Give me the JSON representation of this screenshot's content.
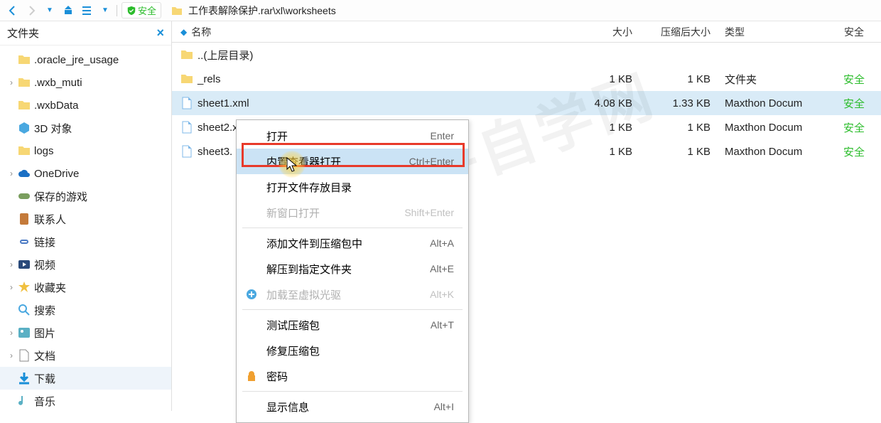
{
  "toolbar": {
    "safe_label": "安全",
    "path": "工作表解除保护.rar\\xl\\worksheets"
  },
  "sidebar": {
    "header": "文件夹",
    "items": [
      {
        "label": ".oracle_jre_usage",
        "expander": "",
        "icon": "folder"
      },
      {
        "label": ".wxb_muti",
        "expander": "›",
        "icon": "folder"
      },
      {
        "label": ".wxbData",
        "expander": "",
        "icon": "folder"
      },
      {
        "label": "3D 对象",
        "expander": "",
        "icon": "3d"
      },
      {
        "label": "logs",
        "expander": "",
        "icon": "folder"
      },
      {
        "label": "OneDrive",
        "expander": "›",
        "icon": "cloud"
      },
      {
        "label": "保存的游戏",
        "expander": "",
        "icon": "game"
      },
      {
        "label": "联系人",
        "expander": "",
        "icon": "contacts"
      },
      {
        "label": "链接",
        "expander": "",
        "icon": "link"
      },
      {
        "label": "视频",
        "expander": "›",
        "icon": "video"
      },
      {
        "label": "收藏夹",
        "expander": "›",
        "icon": "star"
      },
      {
        "label": "搜索",
        "expander": "",
        "icon": "search"
      },
      {
        "label": "图片",
        "expander": "›",
        "icon": "picture"
      },
      {
        "label": "文档",
        "expander": "›",
        "icon": "doc"
      },
      {
        "label": "下载",
        "expander": "",
        "icon": "download",
        "selected": true
      },
      {
        "label": "音乐",
        "expander": "",
        "icon": "music"
      }
    ]
  },
  "columns": {
    "name": "名称",
    "size": "大小",
    "csize": "压缩后大小",
    "type": "类型",
    "safe": "安全"
  },
  "rows": [
    {
      "name": "..(上层目录)",
      "size": "",
      "csize": "",
      "type": "",
      "safe": "",
      "icon": "folder"
    },
    {
      "name": "_rels",
      "size": "1 KB",
      "csize": "1 KB",
      "type": "文件夹",
      "safe": "安全",
      "icon": "folder"
    },
    {
      "name": "sheet1.xml",
      "size": "4.08 KB",
      "csize": "1.33 KB",
      "type": "Maxthon Docum",
      "safe": "安全",
      "icon": "file",
      "selected": true
    },
    {
      "name": "sheet2.x",
      "size": "1 KB",
      "csize": "1 KB",
      "type": "Maxthon Docum",
      "safe": "安全",
      "icon": "file"
    },
    {
      "name": "sheet3.",
      "size": "1 KB",
      "csize": "1 KB",
      "type": "Maxthon Docum",
      "safe": "安全",
      "icon": "file"
    }
  ],
  "context_menu": [
    {
      "label": "打开",
      "shortcut": "Enter"
    },
    {
      "label": "内置查看器打开",
      "shortcut": "Ctrl+Enter",
      "highlight": true
    },
    {
      "label": "打开文件存放目录",
      "shortcut": ""
    },
    {
      "label": "新窗口打开",
      "shortcut": "Shift+Enter",
      "disabled": true
    },
    {
      "sep": true
    },
    {
      "label": "添加文件到压缩包中",
      "shortcut": "Alt+A"
    },
    {
      "label": "解压到指定文件夹",
      "shortcut": "Alt+E"
    },
    {
      "label": "加载至虚拟光驱",
      "shortcut": "Alt+K",
      "disabled": true,
      "icon": "plus"
    },
    {
      "sep": true
    },
    {
      "label": "测试压缩包",
      "shortcut": "Alt+T"
    },
    {
      "label": "修复压缩包",
      "shortcut": ""
    },
    {
      "label": "密码",
      "shortcut": "",
      "icon": "lock"
    },
    {
      "sep": true
    },
    {
      "label": "显示信息",
      "shortcut": "Alt+I"
    }
  ],
  "watermark": "软件自学网"
}
